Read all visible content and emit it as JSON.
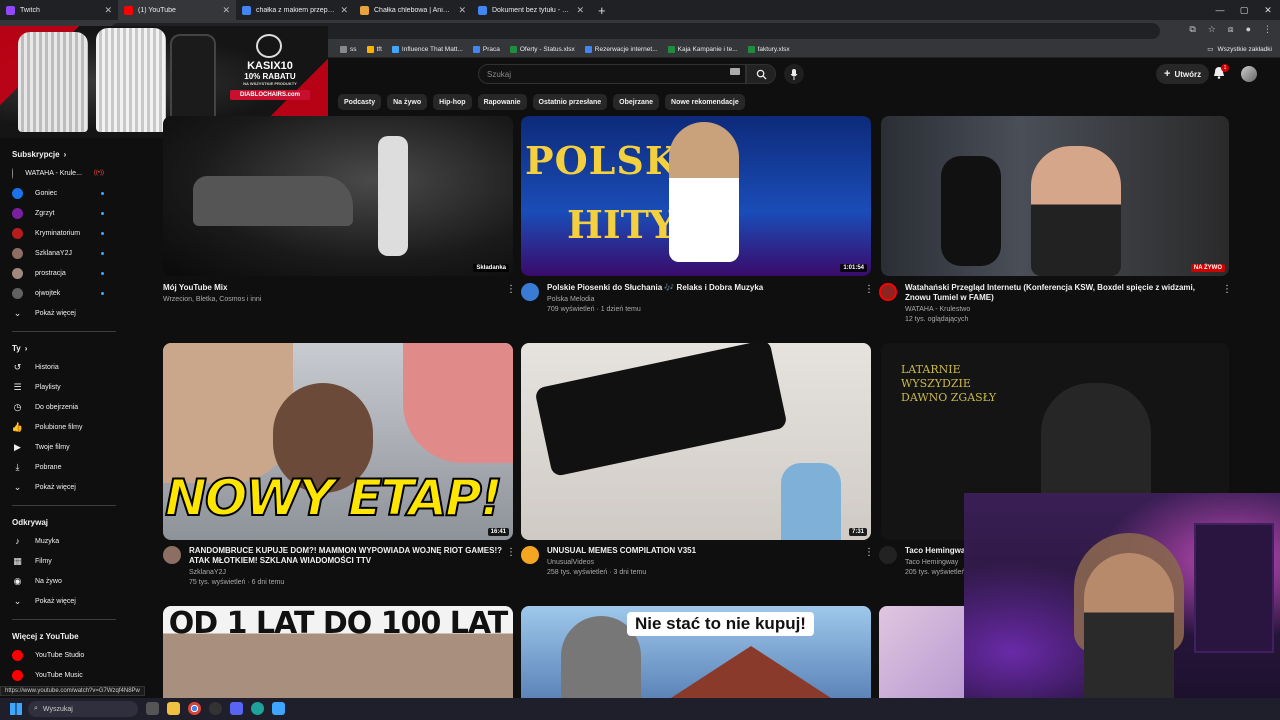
{
  "browser": {
    "tabs": [
      {
        "title": "Twitch",
        "color": "#9146ff"
      },
      {
        "title": "(1) YouTube",
        "color": "#ff0000"
      },
      {
        "title": "chałka z makiem przepis - Szuk",
        "color": "#4285f4"
      },
      {
        "title": "Chałka chlebowa | AniaGotuje",
        "color": "#e8a33d"
      },
      {
        "title": "Dokument bez tytułu - Dokum",
        "color": "#4285f4"
      }
    ],
    "url_fragment": "om",
    "bookmarks": [
      {
        "label": "ss",
        "color": "#888888"
      },
      {
        "label": "tft",
        "color": "#ffb300"
      },
      {
        "label": "Influence That Matt...",
        "color": "#3ea6ff"
      },
      {
        "label": "Praca",
        "color": "#4285f4"
      },
      {
        "label": "Oferty - Status.xlsx",
        "color": "#1e8e3e"
      },
      {
        "label": "Rezerwacje internet...",
        "color": "#4285f4"
      },
      {
        "label": "Kaja Kampanie i te...",
        "color": "#1e8e3e"
      },
      {
        "label": "faktury.xlsx",
        "color": "#1e8e3e"
      }
    ],
    "all_bookmarks": "Wszystkie zakładki",
    "status_url": "https://www.youtube.com/watch?v=G7Wzqf4N8Pw"
  },
  "ad": {
    "brand": "DIABLO",
    "line1": "KASIX10",
    "line2": "10% RABATU",
    "line3": "NA WSZYSTKIE PRODUKTY",
    "line4": "DIABLOCHAIRS.com"
  },
  "header": {
    "search_placeholder": "Szukaj",
    "create_label": "Utwórz",
    "notif_count": "1"
  },
  "chips": [
    "Podcasty",
    "Na żywo",
    "Hip-hop",
    "Rapowanie",
    "Ostatnio przesłane",
    "Obejrzane",
    "Nowe rekomendacje"
  ],
  "sidebar": {
    "subs_title": "Subskrypcje",
    "subs": [
      {
        "name": "WATAHA - Krule...",
        "color": "#888888",
        "state": "live"
      },
      {
        "name": "Goniec",
        "color": "#1a73e8",
        "state": "dot"
      },
      {
        "name": "Zgrzyt",
        "color": "#7b1fa2",
        "state": "dot"
      },
      {
        "name": "Kryminatorium",
        "color": "#b71c1c",
        "state": "dot"
      },
      {
        "name": "SzklanaY2J",
        "color": "#8d6e63",
        "state": "dot"
      },
      {
        "name": "prostracja",
        "color": "#a1887f",
        "state": "dot"
      },
      {
        "name": "ojwojtek",
        "color": "#616161",
        "state": "dot"
      }
    ],
    "subs_more": "Pokaż więcej",
    "you_title": "Ty",
    "you_items": [
      {
        "label": "Historia",
        "icon": "↺"
      },
      {
        "label": "Playlisty",
        "icon": "☰"
      },
      {
        "label": "Do obejrzenia",
        "icon": "◷"
      },
      {
        "label": "Polubione filmy",
        "icon": "👍"
      },
      {
        "label": "Twoje filmy",
        "icon": "▶"
      },
      {
        "label": "Pobrane",
        "icon": "⤓"
      },
      {
        "label": "Pokaż więcej",
        "icon": "⌄"
      }
    ],
    "explore_title": "Odkrywaj",
    "explore_items": [
      {
        "label": "Muzyka",
        "icon": "♪"
      },
      {
        "label": "Filmy",
        "icon": "▦"
      },
      {
        "label": "Na żywo",
        "icon": "◉"
      },
      {
        "label": "Pokaż więcej",
        "icon": "⌄"
      }
    ],
    "more_title": "Więcej z YouTube",
    "more_items": [
      {
        "label": "YouTube Studio",
        "color": "#ff0000"
      },
      {
        "label": "YouTube Music",
        "color": "#ff0000"
      },
      {
        "label": "YouTube Kids",
        "color": "#ff0000"
      }
    ]
  },
  "videos": {
    "v1": {
      "title": "Mój YouTube Mix",
      "sub1": "Wrzecion, Bletka, Cosmos i inni",
      "badge": "Składanka"
    },
    "v2": {
      "title": "Polskie Piosenki do Słuchania 🎶 Relaks i Dobra Muzyka",
      "channel": "Polska Melodia",
      "stats": "709 wyświetleń · 1 dzień temu",
      "duration": "1:01:54",
      "thumb_text1": "POLSKIE",
      "thumb_text2": "HITY"
    },
    "v3": {
      "title": "Watahański Przegląd Internetu (Konferencja KSW, Boxdel spięcie z widzami, Znowu Tumiel w FAME)",
      "channel": "WATAHA - Krulestwo",
      "stats": "12 tys. oglądających",
      "badge": "NA ŻYWO"
    },
    "v4": {
      "title": "RANDOMBRUCE KUPUJE DOM?! MAMMON WYPOWIADA WOJNĘ RIOT GAMES!? ATAK MŁOTKIEM! SZKLANA WIADOMOŚCI TTV",
      "channel": "SzklanaY2J",
      "stats": "75 tys. wyświetleń · 6 dni temu",
      "duration": "16:41",
      "thumb_text": "NOWY ETAP!"
    },
    "v5": {
      "title": "UNUSUAL MEMES COMPILATION V351",
      "channel": "UnusualVideos",
      "stats": "258 tys. wyświetleń · 3 dni temu",
      "duration": "7:31"
    },
    "v6": {
      "title": "Taco Hemingway",
      "channel": "Taco Hemingway",
      "stats": "205 tys. wyświetleń",
      "thumb_text": "LATARNIE WYSZYDZIE DAWNO ZGASŁY"
    },
    "v7": {
      "thumb_text": "OD 1 LAT DO 100 LAT"
    },
    "v8": {
      "thumb_text": "Nie stać to nie kupuj!"
    }
  },
  "taskbar": {
    "search": "Wyszukaj"
  }
}
